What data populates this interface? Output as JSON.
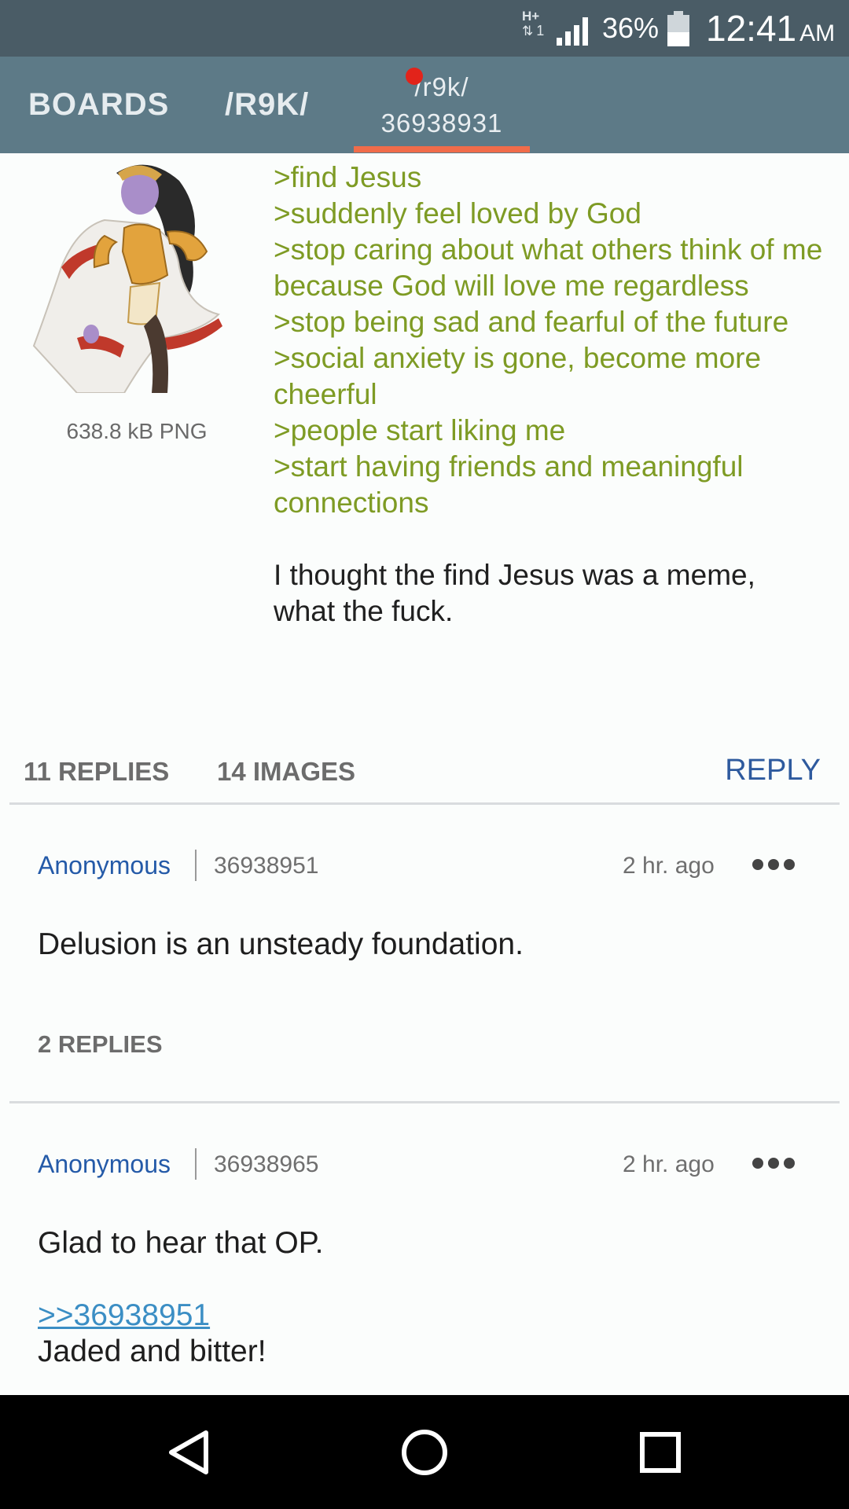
{
  "status_bar": {
    "network": "H+",
    "sim": "1",
    "battery": "36%",
    "time": "12:41",
    "ampm": "AM",
    "bg_color": "#4a5c66"
  },
  "app_bar": {
    "tabs": [
      {
        "label": "BOARDS"
      },
      {
        "label": "/R9K/"
      },
      {
        "board": "/r9k/",
        "thread": "36938931",
        "selected": true
      }
    ],
    "bg_color": "#5d7a87",
    "accent_color": "#f06c4a"
  },
  "op": {
    "file_info": "638.8 kB PNG",
    "greentext": [
      ">find Jesus",
      ">suddenly feel loved by God",
      ">stop caring about what others think of me because God will love me regardless",
      ">stop being sad and fearful of the future",
      ">social anxiety is gone, become more cheerful",
      ">people start liking me",
      ">start having friends and meaningful connections"
    ],
    "text": "I thought the find Jesus was a meme, what the fuck.",
    "replies": "11 REPLIES",
    "images": "14 IMAGES",
    "reply_button": "REPLY"
  },
  "posts": [
    {
      "name": "Anonymous",
      "number": "36938951",
      "time": "2 hr. ago",
      "text": "Delusion is an unsteady foundation.",
      "replies": "2 REPLIES"
    },
    {
      "name": "Anonymous",
      "number": "36938965",
      "time": "2 hr. ago",
      "text": "Glad to hear that OP.",
      "quote": ">>36938951",
      "text2": "Jaded and bitter!"
    }
  ],
  "colors": {
    "greentext": "#7e9b24",
    "name": "#245aa8",
    "link": "#3b8ec4"
  },
  "icons": {
    "more": "more-horizontal-icon",
    "back": "back-triangle-icon",
    "home": "home-circle-icon",
    "recents": "recents-square-icon"
  }
}
